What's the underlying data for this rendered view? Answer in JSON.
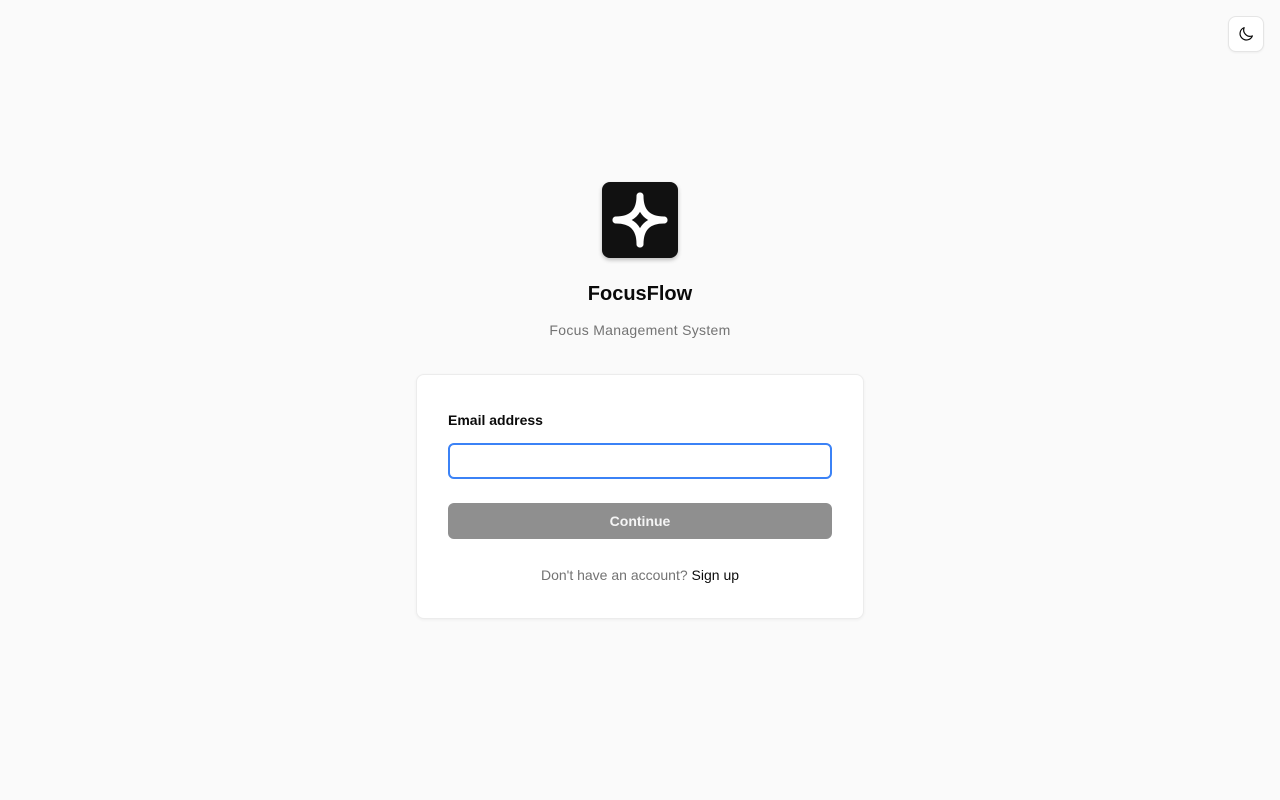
{
  "header": {
    "theme_toggle_icon": "moon-icon"
  },
  "brand": {
    "logo_icon": "sparkle-logo-icon",
    "logo_bg_color": "#111111",
    "name": "FocusFlow",
    "tagline": "Focus Management System"
  },
  "login_form": {
    "email_label": "Email address",
    "email_value": "",
    "email_placeholder": "",
    "continue_label": "Continue",
    "signup_prompt": "Don't have an account?",
    "signup_link": "Sign up",
    "focus_color": "#3b82f6",
    "button_disabled_color": "#8f8f8f"
  }
}
